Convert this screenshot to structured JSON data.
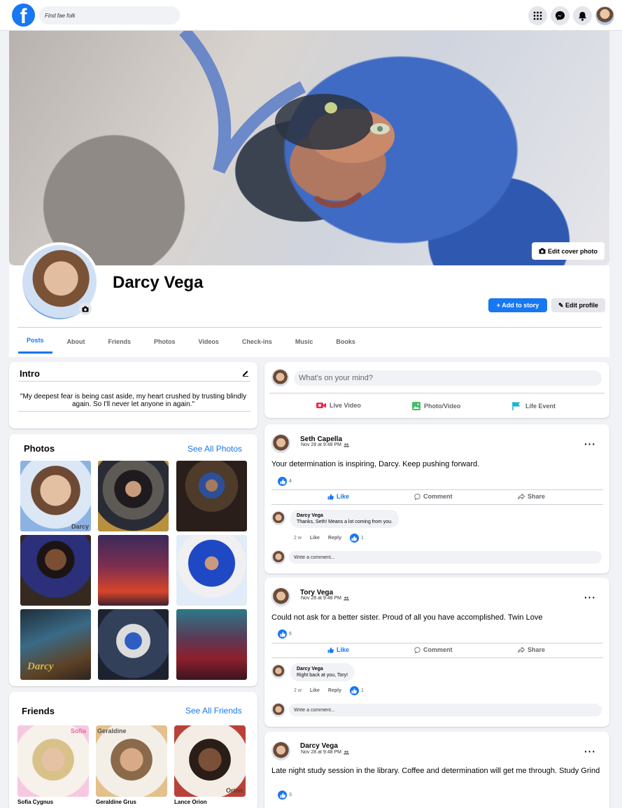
{
  "topbar": {
    "logo": "f",
    "search_placeholder": "Find fae folk",
    "icons": [
      "grid-menu-icon",
      "messenger-icon",
      "bell-icon"
    ]
  },
  "cover": {
    "edit_label": "Edit cover photo"
  },
  "profile": {
    "name": "Darcy Vega",
    "add_story_label": "Add to story",
    "edit_profile_label": "Edit profile"
  },
  "tabs": [
    "Posts",
    "About",
    "Friends",
    "Photos",
    "Videos",
    "Check-ins",
    "Music",
    "Books"
  ],
  "intro": {
    "title": "Intro",
    "quote": "\"My deepest fear is being cast aside, my heart crushed by trusting blindly again. So I'll never let anyone in again.\""
  },
  "photos": {
    "title": "Photos",
    "see_all": "See All Photos",
    "first_photo_caption": "Darcy",
    "seventh_photo_caption": "Darcy"
  },
  "friends": {
    "title": "Friends",
    "see_all": "See All Friends",
    "list": [
      {
        "name": "Sofia Cygnus",
        "caption": "Sofia"
      },
      {
        "name": "Geraldine Grus",
        "caption": "Geraldine"
      },
      {
        "name": "Lance Orion",
        "caption": "Orion"
      }
    ]
  },
  "composer": {
    "placeholder": "What's on your mind?",
    "live": "Live Video",
    "photo": "Photo/Video",
    "event": "Life Event"
  },
  "posts": [
    {
      "author": "Seth Capella",
      "time": "Nov 28 at 9:48 PM",
      "text": "Your determination is inspiring, Darcy. Keep pushing forward.",
      "likes": "4",
      "like_label": "Like",
      "comment_label": "Comment",
      "share_label": "Share",
      "comment": {
        "author": "Darcy Vega",
        "text": "Thanks, Seth! Means a lot coming from you.",
        "age": "2 w",
        "like": "Like",
        "reply": "Reply",
        "likes": "1"
      },
      "write_placeholder": "Write a comment..."
    },
    {
      "author": "Tory Vega",
      "time": "Nov 28 at 9:48 PM",
      "text": "Could not ask for a better sister. Proud of all you have accomplished. Twin Love",
      "likes": "6",
      "like_label": "Like",
      "comment_label": "Comment",
      "share_label": "Share",
      "comment": {
        "author": "Darcy Vega",
        "text": "Right back at you, Tory!",
        "age": "2 w",
        "like": "Like",
        "reply": "Reply",
        "likes": "1"
      },
      "write_placeholder": "Write a comment..."
    },
    {
      "author": "Darcy Vega",
      "time": "Nov 28 at 9:48 PM",
      "text": "Late night study session in the library. Coffee and determination will get me through. Study Grind",
      "likes": "3"
    }
  ],
  "colors": {
    "brand": "#1877f2",
    "background": "#f0f2f5"
  }
}
